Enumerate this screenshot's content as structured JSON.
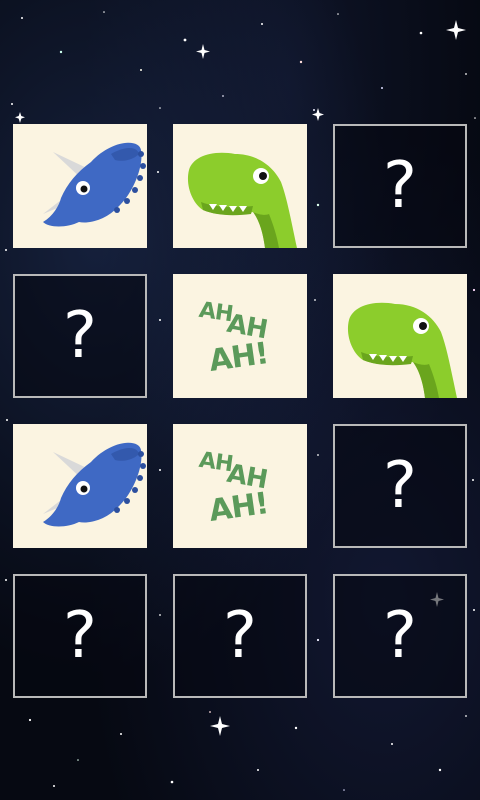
{
  "game": {
    "title": "",
    "hidden_card_symbol": "?",
    "laugh_words": [
      "AH",
      "AH",
      "AH!"
    ]
  },
  "grid": {
    "rows": 4,
    "columns": 3,
    "cards": [
      {
        "row": 1,
        "col": 1,
        "state": "revealed",
        "face": "triceratops"
      },
      {
        "row": 1,
        "col": 2,
        "state": "revealed",
        "face": "t-rex"
      },
      {
        "row": 1,
        "col": 3,
        "state": "hidden",
        "face": ""
      },
      {
        "row": 2,
        "col": 1,
        "state": "hidden",
        "face": ""
      },
      {
        "row": 2,
        "col": 2,
        "state": "revealed",
        "face": "ah-ah-ah"
      },
      {
        "row": 2,
        "col": 3,
        "state": "revealed",
        "face": "t-rex"
      },
      {
        "row": 3,
        "col": 1,
        "state": "revealed",
        "face": "triceratops"
      },
      {
        "row": 3,
        "col": 2,
        "state": "revealed",
        "face": "ah-ah-ah"
      },
      {
        "row": 3,
        "col": 3,
        "state": "hidden",
        "face": ""
      },
      {
        "row": 4,
        "col": 1,
        "state": "hidden",
        "face": ""
      },
      {
        "row": 4,
        "col": 2,
        "state": "hidden",
        "face": ""
      },
      {
        "row": 4,
        "col": 3,
        "state": "hidden",
        "face": ""
      }
    ]
  },
  "colors": {
    "background": "#060912",
    "card_face": "#fbf4e1",
    "card_back_border": "#b9b9b9",
    "triceratops": "#3f69c4",
    "triceratops_dark": "#2c4f9e",
    "horn": "#d9d9d9",
    "trex": "#8ccd2c",
    "trex_dark": "#6aa51d",
    "laugh_text": "#5b9a5a"
  }
}
